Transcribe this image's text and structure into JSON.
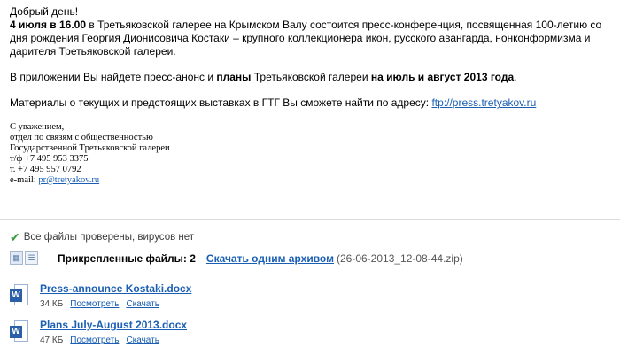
{
  "message": {
    "greeting": "Добрый день!",
    "p1_bold": "4 июля в 16.00",
    "p1_text": " в Третьяковской галерее на Крымском Валу состоится пресс-конференция, посвященная 100-летию со дня рождения Георгия Дионисовича Костаки – крупного коллекционера икон, русского авангарда, нонконформизма и дарителя Третьяковской галереи.",
    "p2_a": "В приложении Вы найдете пресс-анонс и ",
    "p2_b": "планы",
    "p2_c": " Третьяковской галереи ",
    "p2_d": "на июль и август 2013 года",
    "p2_e": ".",
    "p3_text": "Материалы о текущих и предстоящих выставках в ГТГ Вы сможете найти по адресу: ",
    "p3_link": "ftp://press.tretyakov.ru"
  },
  "signature": {
    "line1": "С уважением,",
    "line2": "отдел по связям с общественностью",
    "line3": "Государственной Третьяковской галереи",
    "line4": "т/ф +7 495 953 3375",
    "line5": "т. +7 495 957 0792",
    "email_label": "e-mail: ",
    "email": "pr@tretyakov.ru"
  },
  "attachments": {
    "virus_status": "Все файлы проверены, вирусов нет",
    "title": "Прикрепленные файлы: 2",
    "archive_link": "Скачать одним архивом",
    "archive_name": "(26-06-2013_12-08-44.zip)",
    "files": [
      {
        "name": "Press-announce Kostaki.docx",
        "size": "34 КБ",
        "view": "Посмотреть",
        "download": "Скачать",
        "icon": "word-doc-icon"
      },
      {
        "name": "Plans July-August 2013.docx",
        "size": "47 КБ",
        "view": "Посмотреть",
        "download": "Скачать",
        "icon": "word-doc-icon"
      }
    ]
  },
  "colors": {
    "link": "#1a5fb4",
    "ok": "#3a9b3a",
    "word": "#2b5fa8"
  }
}
